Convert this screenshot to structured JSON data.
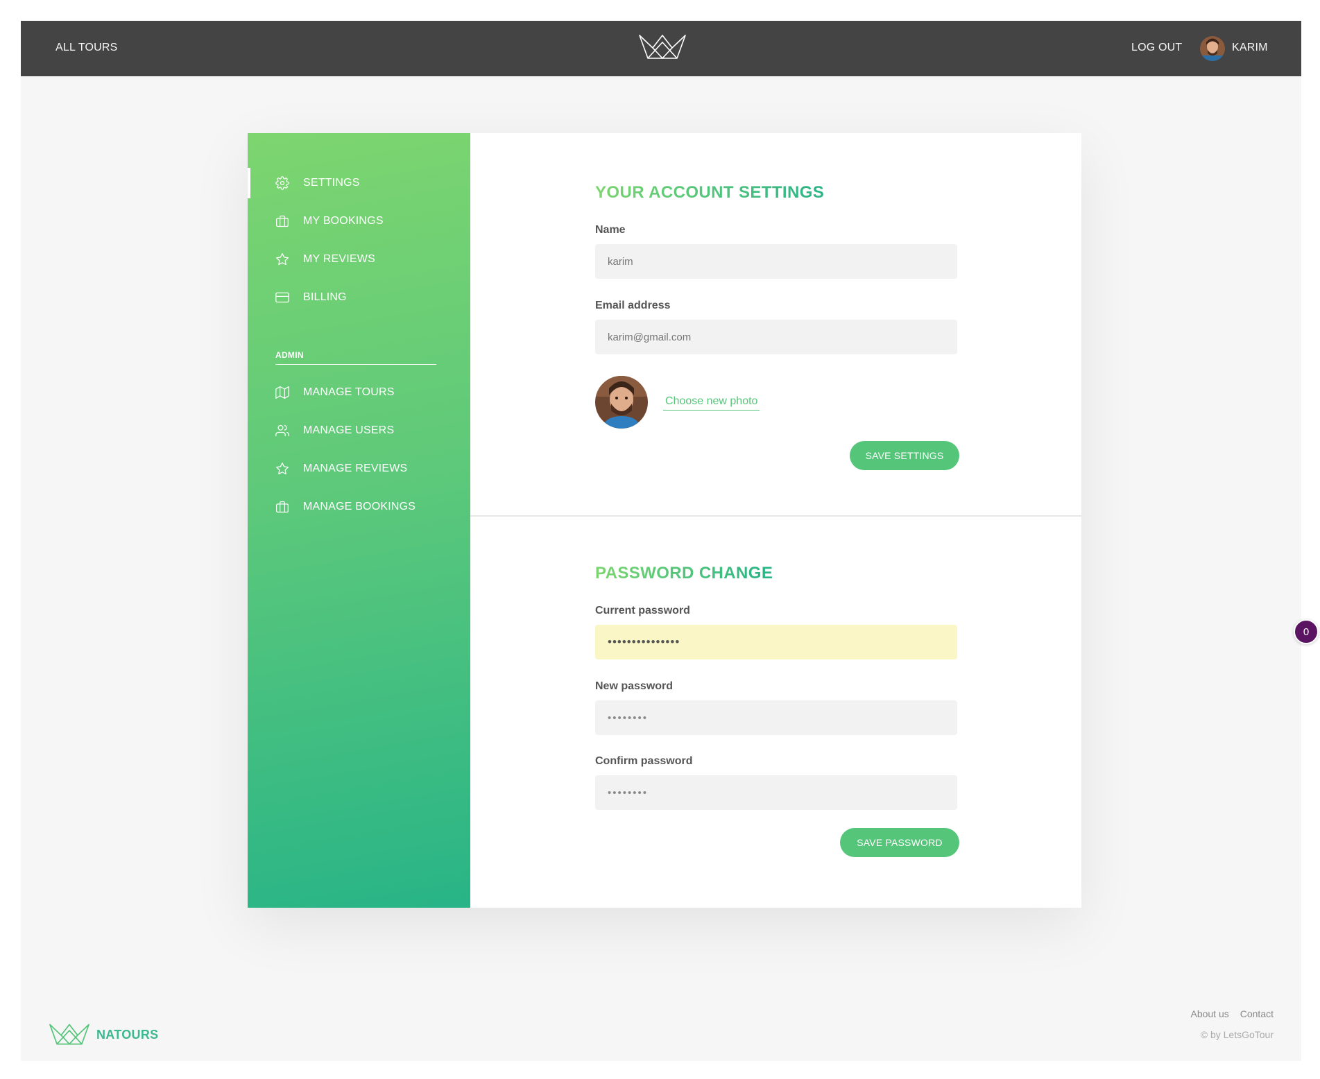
{
  "header": {
    "all_tours": "ALL TOURS",
    "log_out": "LOG OUT",
    "user_name": "KARIM"
  },
  "sidebar": {
    "items": [
      {
        "label": "SETTINGS",
        "icon": "gear-icon",
        "active": true
      },
      {
        "label": "MY BOOKINGS",
        "icon": "briefcase-icon"
      },
      {
        "label": "MY REVIEWS",
        "icon": "star-icon"
      },
      {
        "label": "BILLING",
        "icon": "credit-card-icon"
      }
    ],
    "admin_heading": "ADMIN",
    "admin_items": [
      {
        "label": "MANAGE TOURS",
        "icon": "map-icon"
      },
      {
        "label": "MANAGE USERS",
        "icon": "users-icon"
      },
      {
        "label": "MANAGE REVIEWS",
        "icon": "star-icon"
      },
      {
        "label": "MANAGE BOOKINGS",
        "icon": "briefcase-icon"
      }
    ]
  },
  "account": {
    "heading": "YOUR ACCOUNT SETTINGS",
    "name_label": "Name",
    "name_value": "karim",
    "email_label": "Email address",
    "email_value": "karim@gmail.com",
    "photo_link": "Choose new photo",
    "save_button": "SAVE SETTINGS"
  },
  "password": {
    "heading": "PASSWORD CHANGE",
    "current_label": "Current password",
    "current_value": "•••••••••••••••",
    "new_label": "New password",
    "new_placeholder": "••••••••",
    "confirm_label": "Confirm password",
    "confirm_placeholder": "••••••••",
    "save_button": "SAVE PASSWORD"
  },
  "footer": {
    "brand": "NATOURS",
    "about": "About us",
    "contact": "Contact",
    "copyright": "© by LetsGoTour"
  },
  "badge": {
    "count": "0"
  },
  "colors": {
    "header_bg": "#444444",
    "accent": "#55c57a",
    "gradient_start": "#7dd56f",
    "gradient_end": "#28b487",
    "autofill": "#faf6c6",
    "badge": "#5a1462"
  }
}
